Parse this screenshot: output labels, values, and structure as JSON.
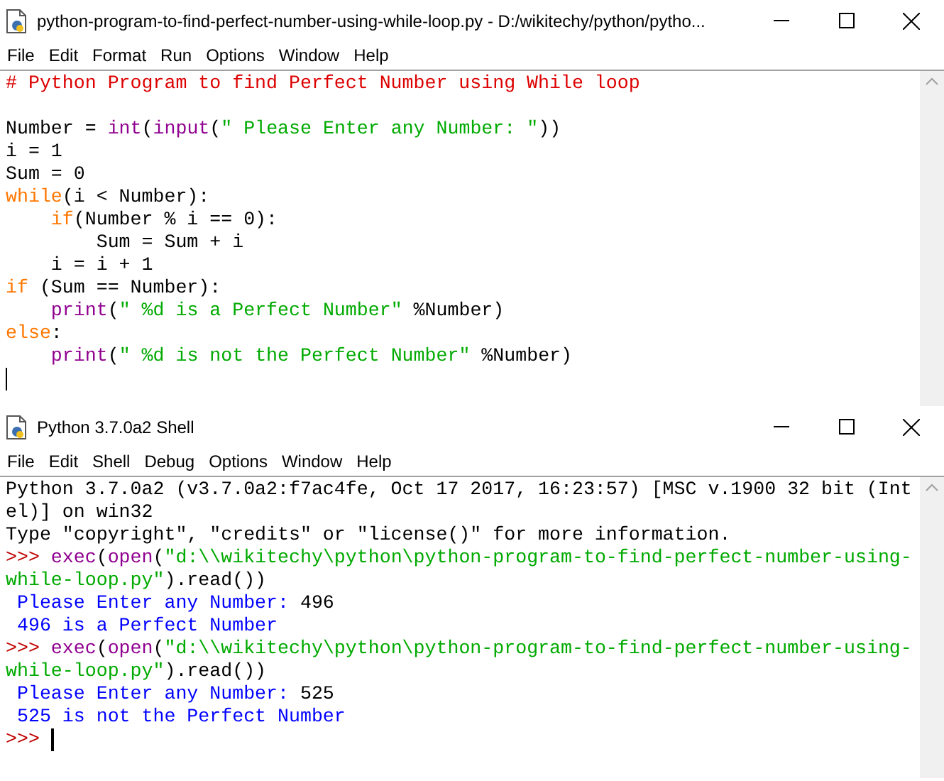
{
  "windows": [
    {
      "title": "python-program-to-find-perfect-number-using-while-loop.py - D:/wikitechy/python/pytho...",
      "menu": [
        "File",
        "Edit",
        "Format",
        "Run",
        "Options",
        "Window",
        "Help"
      ],
      "kind": "editor",
      "lines": [
        {
          "tokens": [
            {
              "kind": "comment",
              "text": "# Python Program to find Perfect Number using While loop"
            }
          ]
        },
        {
          "kind": "blank"
        },
        {
          "tokens": [
            {
              "kind": "plain",
              "text": "Number = "
            },
            {
              "kind": "builtin",
              "text": "int"
            },
            {
              "kind": "plain",
              "text": "("
            },
            {
              "kind": "builtin",
              "text": "input"
            },
            {
              "kind": "plain",
              "text": "("
            },
            {
              "kind": "string",
              "text": "\" Please Enter any Number: \""
            },
            {
              "kind": "plain",
              "text": "))"
            }
          ]
        },
        {
          "tokens": [
            {
              "kind": "plain",
              "text": "i = 1"
            }
          ]
        },
        {
          "tokens": [
            {
              "kind": "plain",
              "text": "Sum = 0"
            }
          ]
        },
        {
          "tokens": [
            {
              "kind": "keyword",
              "text": "while"
            },
            {
              "kind": "plain",
              "text": "(i < Number):"
            }
          ]
        },
        {
          "tokens": [
            {
              "kind": "keyword",
              "text": "    if"
            },
            {
              "kind": "plain",
              "text": "(Number % i == 0):"
            }
          ]
        },
        {
          "tokens": [
            {
              "kind": "plain",
              "text": "        Sum = Sum + i"
            }
          ]
        },
        {
          "tokens": [
            {
              "kind": "plain",
              "text": "    i = i + 1"
            }
          ]
        },
        {
          "tokens": [
            {
              "kind": "keyword",
              "text": "if"
            },
            {
              "kind": "plain",
              "text": " (Sum == Number):"
            }
          ]
        },
        {
          "tokens": [
            {
              "kind": "builtin",
              "text": "    print"
            },
            {
              "kind": "plain",
              "text": "("
            },
            {
              "kind": "string",
              "text": "\" %d is a Perfect Number\""
            },
            {
              "kind": "plain",
              "text": " %Number)"
            }
          ]
        },
        {
          "tokens": [
            {
              "kind": "keyword",
              "text": "else"
            },
            {
              "kind": "plain",
              "text": ":"
            }
          ]
        },
        {
          "tokens": [
            {
              "kind": "builtin",
              "text": "    print"
            },
            {
              "kind": "plain",
              "text": "("
            },
            {
              "kind": "string",
              "text": "\" %d is not the Perfect Number\""
            },
            {
              "kind": "plain",
              "text": " %Number)"
            }
          ]
        },
        {
          "cursor": true
        }
      ]
    },
    {
      "title": "Python 3.7.0a2 Shell",
      "menu": [
        "File",
        "Edit",
        "Shell",
        "Debug",
        "Options",
        "Window",
        "Help"
      ],
      "kind": "shell",
      "lines": [
        {
          "tokens": [
            {
              "kind": "plain",
              "text": "Python 3.7.0a2 (v3.7.0a2:f7ac4fe, Oct 17 2017, 16:23:57) [MSC v.1900 32 bit (Int"
            }
          ]
        },
        {
          "tokens": [
            {
              "kind": "plain",
              "text": "el)] on win32"
            }
          ]
        },
        {
          "tokens": [
            {
              "kind": "plain",
              "text": "Type \"copyright\", \"credits\" or \"license()\" for more information."
            }
          ]
        },
        {
          "tokens": [
            {
              "kind": "prompt",
              "text": ">>> "
            },
            {
              "kind": "builtin",
              "text": "exec"
            },
            {
              "kind": "plain",
              "text": "("
            },
            {
              "kind": "builtin",
              "text": "open"
            },
            {
              "kind": "plain",
              "text": "("
            },
            {
              "kind": "string",
              "text": "\"d:\\\\wikitechy\\python\\python-program-to-find-perfect-number-using-"
            }
          ]
        },
        {
          "tokens": [
            {
              "kind": "string",
              "text": "while-loop.py\""
            },
            {
              "kind": "plain",
              "text": ").read())"
            }
          ]
        },
        {
          "tokens": [
            {
              "kind": "stdout",
              "text": " Please Enter any Number: "
            },
            {
              "kind": "plain",
              "text": "496"
            }
          ]
        },
        {
          "tokens": [
            {
              "kind": "stdout",
              "text": " 496 is a Perfect Number"
            }
          ]
        },
        {
          "tokens": [
            {
              "kind": "prompt",
              "text": ">>> "
            },
            {
              "kind": "builtin",
              "text": "exec"
            },
            {
              "kind": "plain",
              "text": "("
            },
            {
              "kind": "builtin",
              "text": "open"
            },
            {
              "kind": "plain",
              "text": "("
            },
            {
              "kind": "string",
              "text": "\"d:\\\\wikitechy\\python\\python-program-to-find-perfect-number-using-"
            }
          ]
        },
        {
          "tokens": [
            {
              "kind": "string",
              "text": "while-loop.py\""
            },
            {
              "kind": "plain",
              "text": ").read())"
            }
          ]
        },
        {
          "tokens": [
            {
              "kind": "stdout",
              "text": " Please Enter any Number: "
            },
            {
              "kind": "plain",
              "text": "525"
            }
          ]
        },
        {
          "tokens": [
            {
              "kind": "stdout",
              "text": " 525 is not the Perfect Number"
            }
          ]
        },
        {
          "cursor": true,
          "tokens": [
            {
              "kind": "prompt",
              "text": ">>> "
            }
          ]
        }
      ]
    }
  ]
}
